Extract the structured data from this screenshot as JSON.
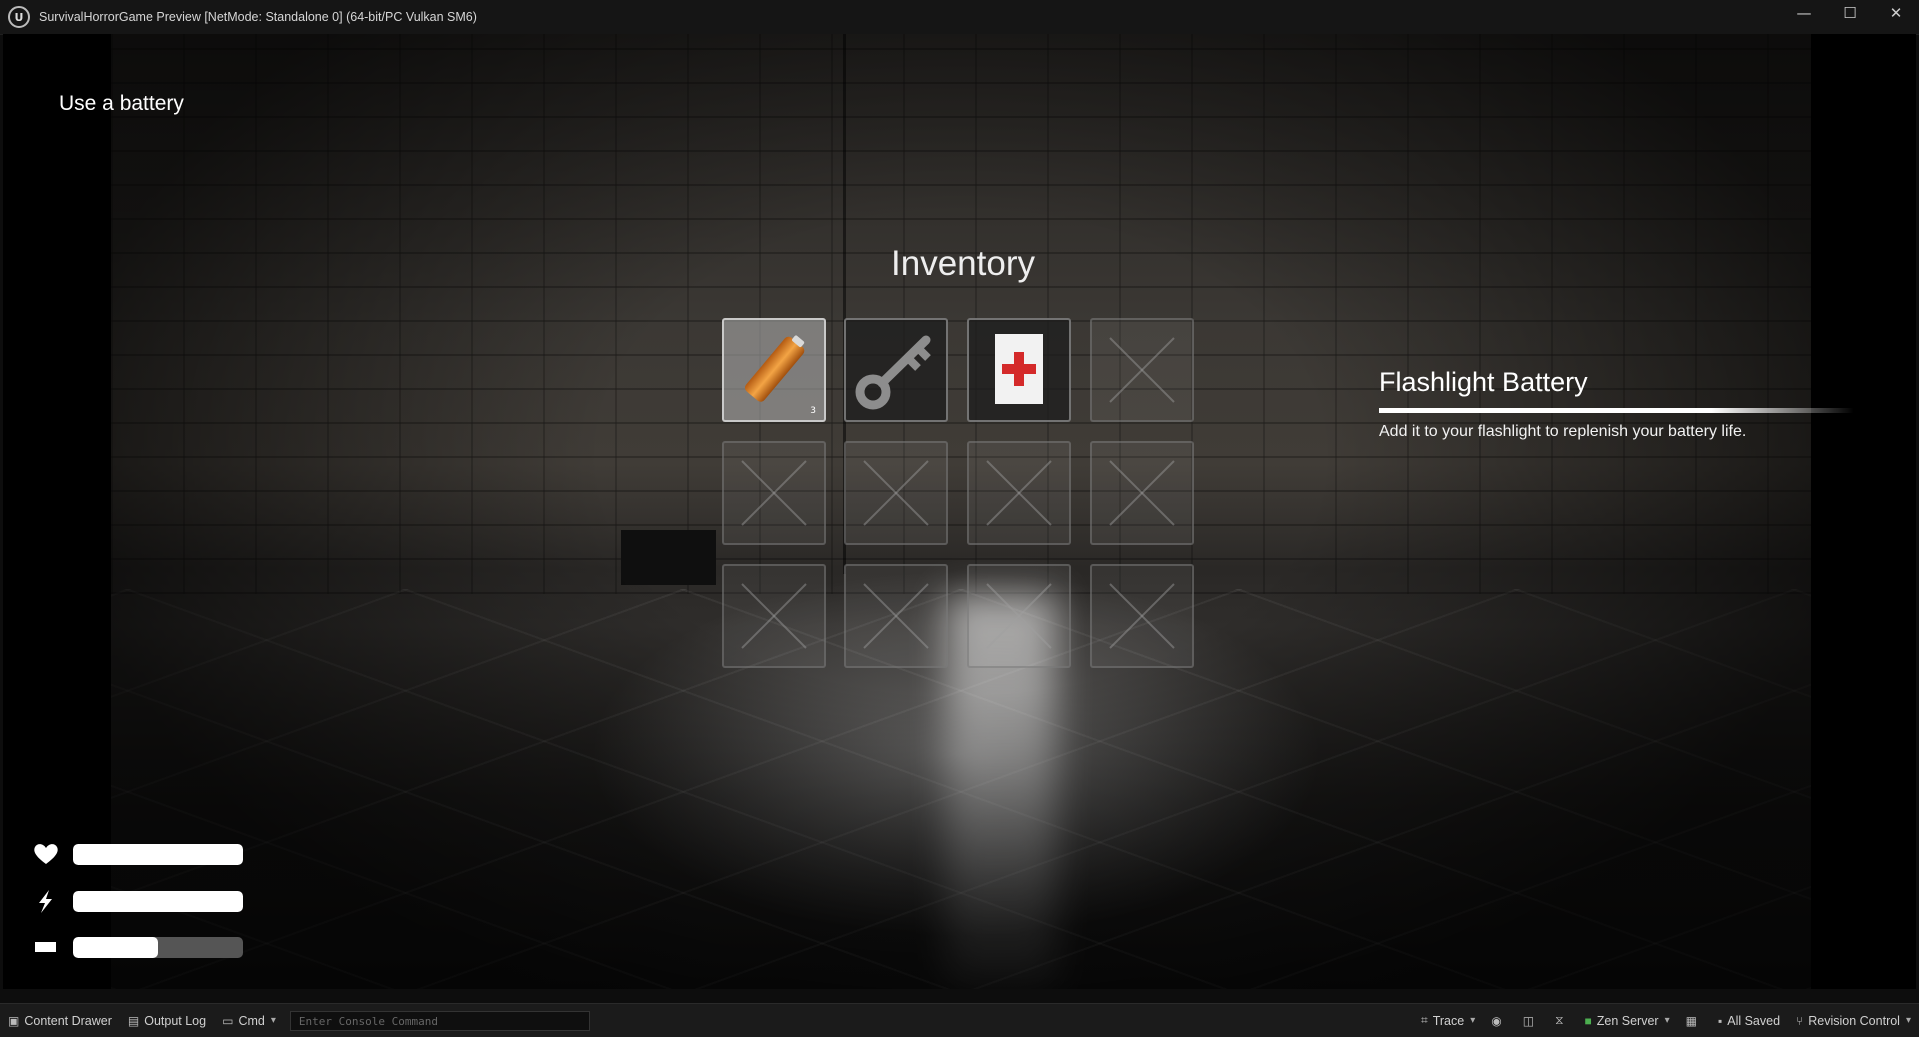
{
  "window": {
    "title": "SurvivalHorrorGame Preview [NetMode: Standalone 0]  (64-bit/PC Vulkan SM6)",
    "logo": "U",
    "controls": {
      "minimize": "—",
      "maximize": "☐",
      "close": "✕"
    }
  },
  "hud": {
    "objective": "Use a battery",
    "stats": [
      {
        "icon": "heart-icon",
        "level": 1.0
      },
      {
        "icon": "lightning-icon",
        "level": 1.0
      },
      {
        "icon": "battery-icon",
        "level": 0.5
      }
    ]
  },
  "inventory": {
    "title": "Inventory",
    "slots": [
      {
        "item": "battery",
        "count": "3",
        "selected": true
      },
      {
        "item": "key",
        "count": ""
      },
      {
        "item": "medkit",
        "count": ""
      },
      {
        "item": "empty"
      },
      {
        "item": "empty"
      },
      {
        "item": "empty"
      },
      {
        "item": "empty"
      },
      {
        "item": "empty"
      },
      {
        "item": "empty"
      },
      {
        "item": "empty"
      },
      {
        "item": "empty"
      },
      {
        "item": "empty"
      }
    ],
    "detail": {
      "name": "Flashlight Battery",
      "description": "Add it to your flashlight to replenish your battery life."
    }
  },
  "toolbar": {
    "content_drawer": "Content Drawer",
    "output_log": "Output Log",
    "cmd": "Cmd",
    "console_placeholder": "Enter Console Command",
    "trace": "Trace",
    "zen_server": "Zen Server",
    "all_saved": "All Saved",
    "revision_control": "Revision Control"
  }
}
